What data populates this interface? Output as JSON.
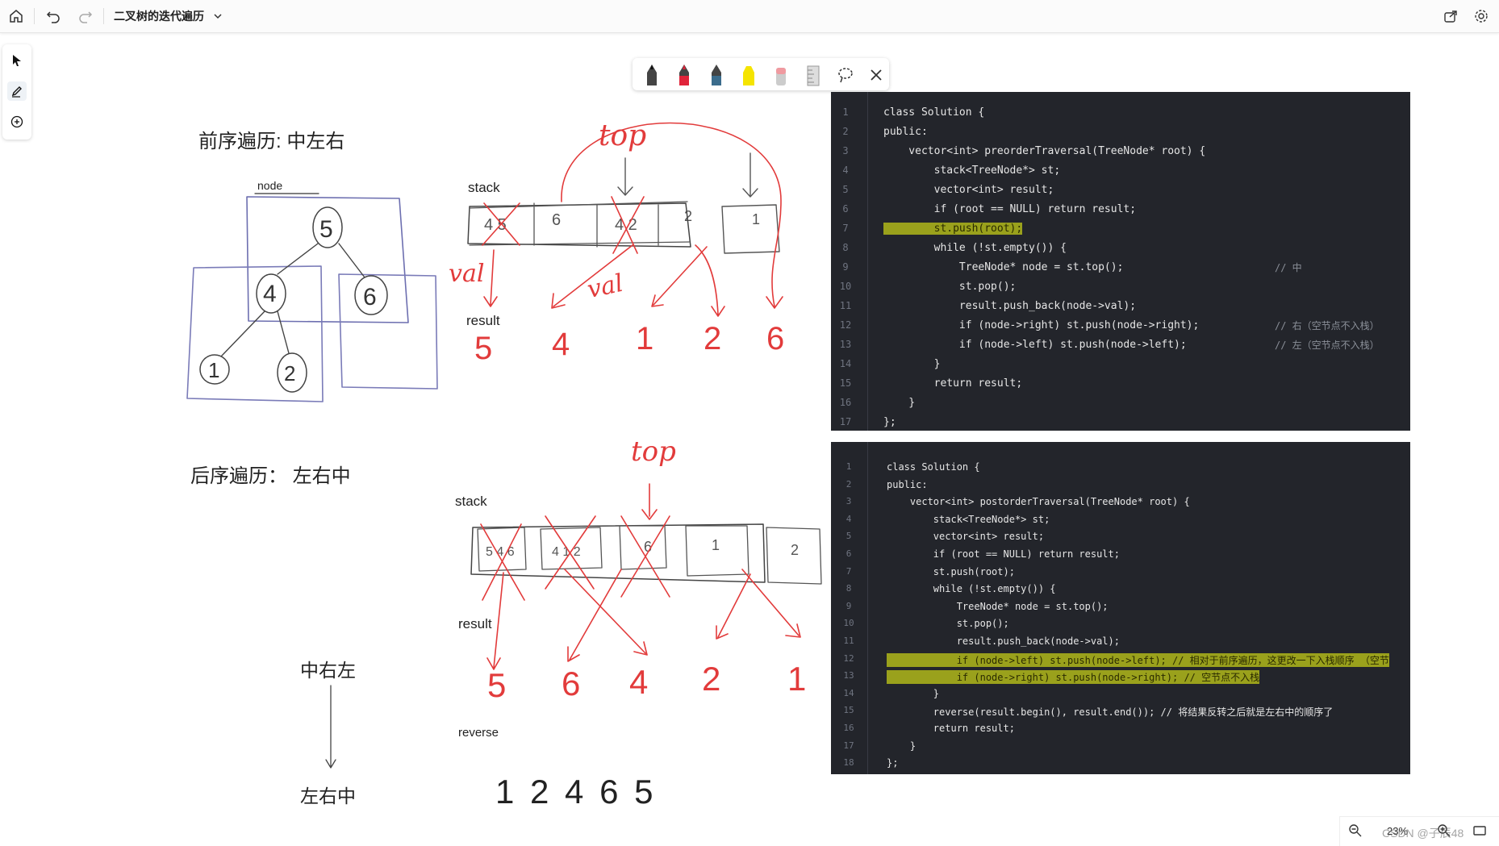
{
  "toolbar": {
    "title": "二叉树的迭代遍历",
    "home_icon": "home-icon",
    "undo_icon": "undo-icon",
    "redo_icon": "redo-icon",
    "share_icon": "share-icon",
    "settings_icon": "gear-icon"
  },
  "left_tools": [
    "select-pointer-icon",
    "pen-icon",
    "add-icon"
  ],
  "pen_tools": {
    "colors": [
      "#222222",
      "#e0243a",
      "#3b6c8c",
      "#f5e400",
      "#f09aa0"
    ],
    "ruler_icon": "ruler-icon",
    "lasso_icon": "lasso-icon",
    "close_icon": "close-icon"
  },
  "notes": {
    "preorder_title": "前序遍历: 中左右",
    "postorder_title": "后序遍历：  左右中",
    "node_label": "node",
    "stack_label_1": "stack",
    "stack_label_2": "stack",
    "result_label_1": "result",
    "result_label_2": "result",
    "reverse_label": "reverse",
    "top_label_1": "top",
    "top_label_2": "top",
    "val_label_1": "val",
    "val_label_2": "val",
    "order_mid_right_left": "中右左",
    "order_left_right_mid": "左右中",
    "tree_nodes": [
      "5",
      "4",
      "6",
      "1",
      "2"
    ],
    "stack1_cells": [
      "4 5",
      "6",
      "4 2",
      "2",
      "1"
    ],
    "result1": [
      "5",
      "4",
      "1",
      "2",
      "6"
    ],
    "stack2_cells": [
      "5 4 6",
      "4 1 2",
      "6",
      "1",
      "2"
    ],
    "result2": [
      "5",
      "6",
      "4",
      "2",
      "1"
    ],
    "reverse_result": "1  2  4  6  5"
  },
  "code_preorder": {
    "line_numbers": [
      "1",
      "2",
      "3",
      "4",
      "5",
      "6",
      "7",
      "8",
      "9",
      "10",
      "11",
      "12",
      "13",
      "14",
      "15",
      "16",
      "17"
    ],
    "lines": [
      "class Solution {",
      "public:",
      "    vector<int> preorderTraversal(TreeNode* root) {",
      "        stack<TreeNode*> st;",
      "        vector<int> result;",
      "        if (root == NULL) return result;",
      "        st.push(root);",
      "        while (!st.empty()) {",
      "            TreeNode* node = st.top();",
      "            st.pop();",
      "            result.push_back(node->val);",
      "            if (node->right) st.push(node->right);",
      "            if (node->left) st.push(node->left);",
      "        }",
      "        return result;",
      "    }",
      "};"
    ],
    "comment_9": "// 中",
    "comment_12": "// 右（空节点不入栈）",
    "comment_13": "// 左（空节点不入栈）"
  },
  "code_postorder": {
    "line_numbers": [
      "1",
      "2",
      "3",
      "4",
      "5",
      "6",
      "7",
      "8",
      "9",
      "10",
      "11",
      "12",
      "13",
      "14",
      "15",
      "16",
      "17",
      "18"
    ],
    "lines": [
      "class Solution {",
      "public:",
      "    vector<int> postorderTraversal(TreeNode* root) {",
      "        stack<TreeNode*> st;",
      "        vector<int> result;",
      "        if (root == NULL) return result;",
      "        st.push(root);",
      "        while (!st.empty()) {",
      "            TreeNode* node = st.top();",
      "            st.pop();",
      "            result.push_back(node->val);",
      "            if (node->left) st.push(node->left); // 相对于前序遍历，这更改一下入栈顺序 （空节",
      "            if (node->right) st.push(node->right); // 空节点不入栈",
      "        }",
      "        reverse(result.begin(), result.end()); // 将结果反转之后就是左右中的顺序了",
      "        return result;",
      "    }",
      "};"
    ]
  },
  "zoom": {
    "zoom_out_icon": "zoom-out-icon",
    "level": "23%",
    "zoom_in_icon": "zoom-in-icon",
    "fit_icon": "fit-screen-icon",
    "watermark": "CSDN @子辰48"
  }
}
